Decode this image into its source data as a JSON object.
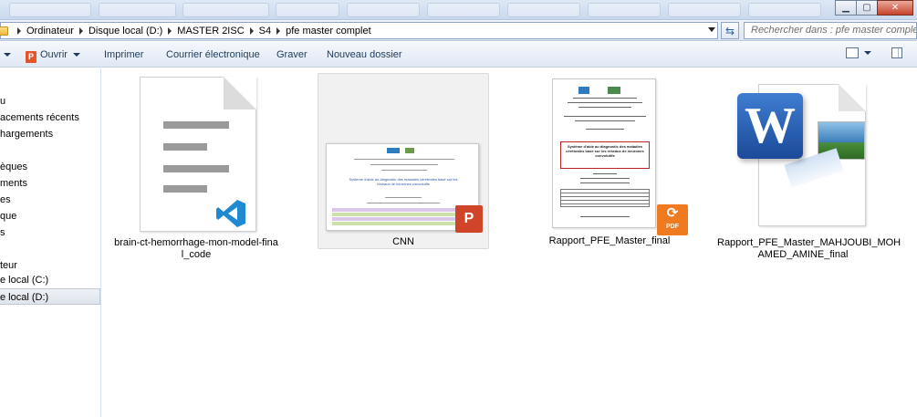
{
  "window": {
    "controls": {
      "minimize": "▁",
      "maximize": "▢",
      "close": "✕"
    }
  },
  "address_bar": {
    "crumbs": [
      "Ordinateur",
      "Disque local (D:)",
      "MASTER 2ISC",
      "S4",
      "pfe master complet"
    ],
    "search_placeholder": "Rechercher dans : pfe master complet"
  },
  "toolbar": {
    "open_label": "Ouvrir",
    "print_label": "Imprimer",
    "email_label": "Courrier électronique",
    "burn_label": "Graver",
    "new_folder_label": "Nouveau dossier"
  },
  "nav_pane": {
    "items": [
      {
        "label": "u"
      },
      {
        "label": "acements récents"
      },
      {
        "label": "hargements"
      },
      {
        "label": ""
      },
      {
        "label": "èques"
      },
      {
        "label": "ments"
      },
      {
        "label": "es"
      },
      {
        "label": "que"
      },
      {
        "label": "s"
      },
      {
        "label": ""
      },
      {
        "label": "teur"
      },
      {
        "label": "e local (C:)"
      },
      {
        "label": "e local (D:)"
      }
    ]
  },
  "files": [
    {
      "name": "brain-ct-hemorrhage-mon-model-final_code",
      "line1": "brain-ct-hemorrhage-mon-model-fina",
      "line2": "l_code",
      "type": "vscode"
    },
    {
      "name": "CNN",
      "line1": "CNN",
      "line2": "",
      "type": "powerpoint"
    },
    {
      "name": "Rapport_PFE_Master_final",
      "line1": "Rapport_PFE_Master_final",
      "line2": "",
      "type": "pdf"
    },
    {
      "name": "Rapport_PFE_Master_MAHJOUBI_MOHAMED_AMINE_final",
      "line1": "Rapport_PFE_Master_MAHJOUBI_MOH",
      "line2": "AMED_AMINE_final",
      "type": "word"
    }
  ],
  "thumb_text": {
    "ppt_title": "Système d'aide au diagnostic des maladies cérébrales basé sur les réseaux de neurones convolutifs",
    "pdf_title": "Système d'aide au diagnostic des maladies cérébrales basé sur les réseaux de neurones convolutifs",
    "pdf_badge": "PDF",
    "ppt_badge": "P",
    "word_badge": "W"
  },
  "colors": {
    "accent": "#1e395b",
    "vscode": "#1f8ad2",
    "ppt": "#d0452a",
    "pdf": "#f07a1f",
    "word": "#2b579a"
  }
}
